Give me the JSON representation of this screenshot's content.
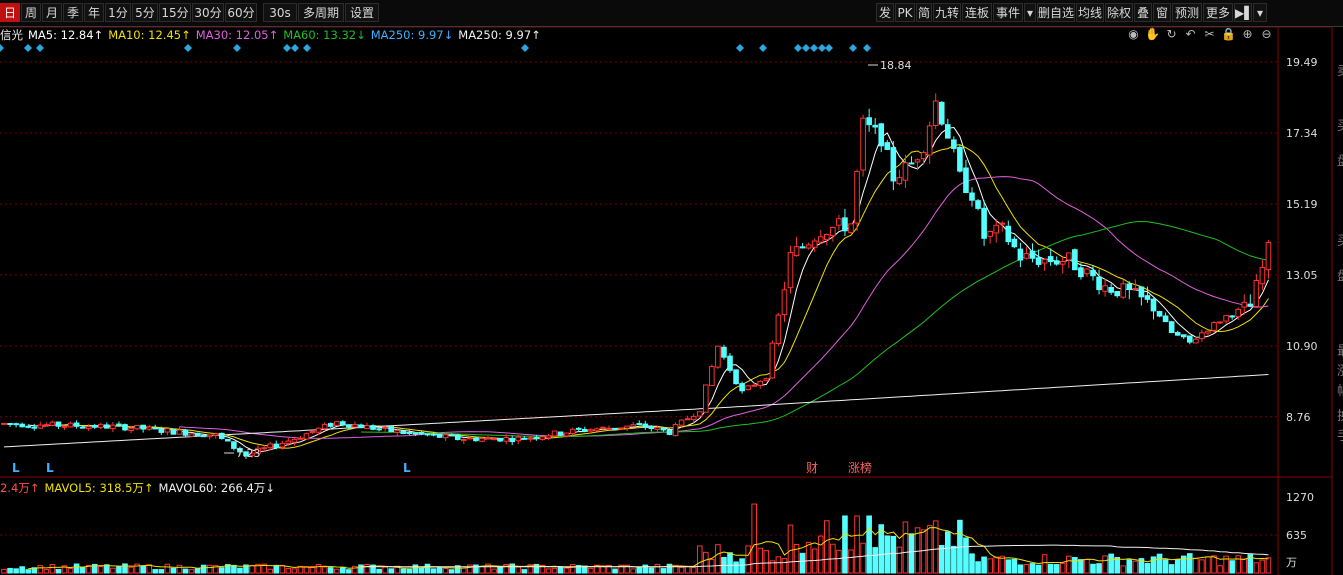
{
  "toolbar": {
    "left_buttons": [
      "日",
      "周",
      "月",
      "季",
      "年",
      "1分",
      "5分",
      "15分",
      "30分",
      "60分",
      "30s",
      "多周期",
      "设置"
    ],
    "right_buttons": [
      "发",
      "PK",
      "简",
      "九转",
      "连板",
      "事件",
      "▾",
      "删自选",
      "均线",
      "除权",
      "叠",
      "窗",
      "预测",
      "更多",
      "▶▌",
      "▾"
    ]
  },
  "ma_line": [
    {
      "label": "MA5: 12.84↑",
      "color": "#ffffff"
    },
    {
      "label": "MA10: 12.45↑",
      "color": "#f0e000"
    },
    {
      "label": "MA30: 12.05↑",
      "color": "#e060e0"
    },
    {
      "label": "MA60: 13.32↓",
      "color": "#20c020"
    },
    {
      "label": "MA250: 9.97↓",
      "color": "#40b0ff"
    },
    {
      "label": "MA250: 9.97↑",
      "color": "#f0f0f0"
    }
  ],
  "ma_prefix": "信光",
  "vol_line": [
    {
      "label": "2.4万↑",
      "color": "#ff5050"
    },
    {
      "label": "MAVOL5: 318.5万↑",
      "color": "#f0e000"
    },
    {
      "label": "MAVOL60: 266.4万↓",
      "color": "#f0f0f0"
    }
  ],
  "chart_data": {
    "type": "candlestick",
    "price_axis_ticks": [
      "19.49",
      "17.34",
      "15.19",
      "13.05",
      "10.90",
      "8.76"
    ],
    "volume_axis_ticks": [
      "1270",
      "635",
      "万"
    ],
    "high_label": "18.84",
    "low_label": "7.23",
    "annotations": [
      "财",
      "涨榜"
    ],
    "markers": [
      "L",
      "L",
      "L"
    ],
    "right_col_chars": [
      "卖",
      "买",
      "盘",
      "买",
      "盘",
      "最",
      "涨",
      "幅",
      "换",
      "手"
    ]
  },
  "icons": [
    "eye-icon",
    "hand-icon",
    "refresh-icon",
    "undo-icon",
    "scissors-icon",
    "lock-icon",
    "zoom-in-icon",
    "zoom-out-icon"
  ],
  "icon_glyphs": [
    "◉",
    "✋",
    "↻",
    "↶",
    "✂",
    "🔒",
    "⊕",
    "⊖"
  ],
  "colors": {
    "up": "#ff3232",
    "down": "#54ffff",
    "bg": "#000000",
    "grid": "#8b0000"
  }
}
